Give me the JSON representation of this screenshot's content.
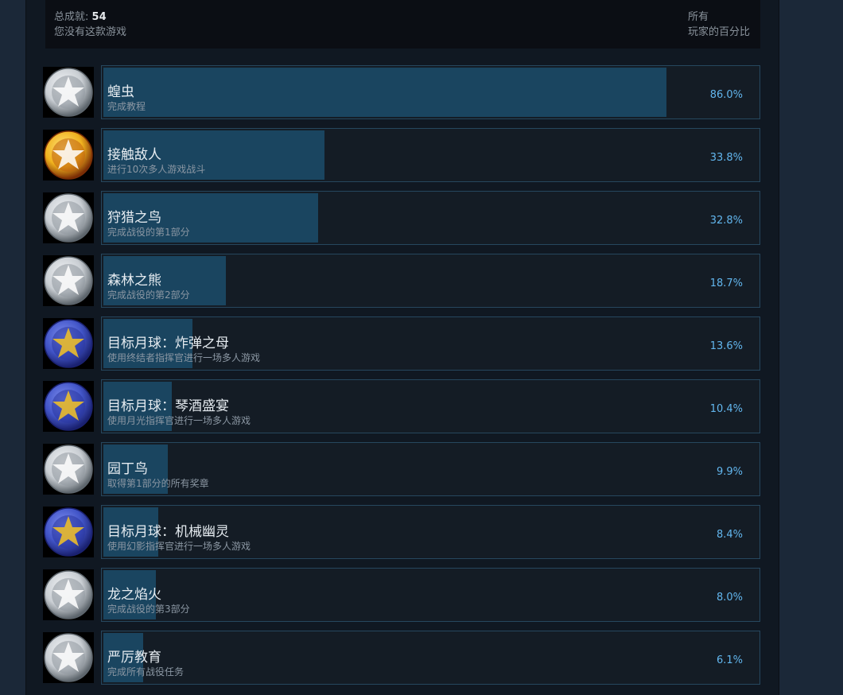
{
  "summary": {
    "total_label": "总成就:",
    "total_value": "54",
    "not_owned": "您没有这款游戏",
    "percent_header_line1": "所有",
    "percent_header_line2": "玩家的百分比"
  },
  "achievements": [
    {
      "title": "蝗虫",
      "desc": "完成教程",
      "percent_text": "86.0%",
      "percent": 86.0,
      "icon": "star-info-badge-icon",
      "icon_style": "silver"
    },
    {
      "title": "接触敌人",
      "desc": "进行10次多人游戏战斗",
      "percent_text": "33.8%",
      "percent": 33.8,
      "icon": "versus-flame-medal-icon",
      "icon_style": "gold"
    },
    {
      "title": "狩猎之鸟",
      "desc": "完成战役的第1部分",
      "percent_text": "32.8%",
      "percent": 32.8,
      "icon": "bird-emblem-icon",
      "icon_style": "silver"
    },
    {
      "title": "森林之熊",
      "desc": "完成战役的第2部分",
      "percent_text": "18.7%",
      "percent": 18.7,
      "icon": "bear-star-badge-icon",
      "icon_style": "silver"
    },
    {
      "title": "目标月球：炸弹之母",
      "desc": "使用终结者指挥官进行一场多人游戏",
      "percent_text": "13.6%",
      "percent": 13.6,
      "icon": "moon-laurel-medal-icon",
      "icon_style": "blue"
    },
    {
      "title": "目标月球：琴酒盛宴",
      "desc": "使用月光指挥官进行一场多人游戏",
      "percent_text": "10.4%",
      "percent": 10.4,
      "icon": "bottle-laurel-medal-icon",
      "icon_style": "blue"
    },
    {
      "title": "园丁鸟",
      "desc": "取得第1部分的所有奖章",
      "percent_text": "9.9%",
      "percent": 9.9,
      "icon": "gardener-bird-badge-icon",
      "icon_style": "silver"
    },
    {
      "title": "目标月球：机械幽灵",
      "desc": "使用幻影指挥官进行一场多人游戏",
      "percent_text": "8.4%",
      "percent": 8.4,
      "icon": "ghost-laurel-medal-icon",
      "icon_style": "blue"
    },
    {
      "title": "龙之焰火",
      "desc": "完成战役的第3部分",
      "percent_text": "8.0%",
      "percent": 8.0,
      "icon": "dragon-badge-icon",
      "icon_style": "silver"
    },
    {
      "title": "严厉教育",
      "desc": "完成所有战役任务",
      "percent_text": "6.1%",
      "percent": 6.1,
      "icon": "globe-star-badge-icon",
      "icon_style": "silver"
    }
  ]
}
